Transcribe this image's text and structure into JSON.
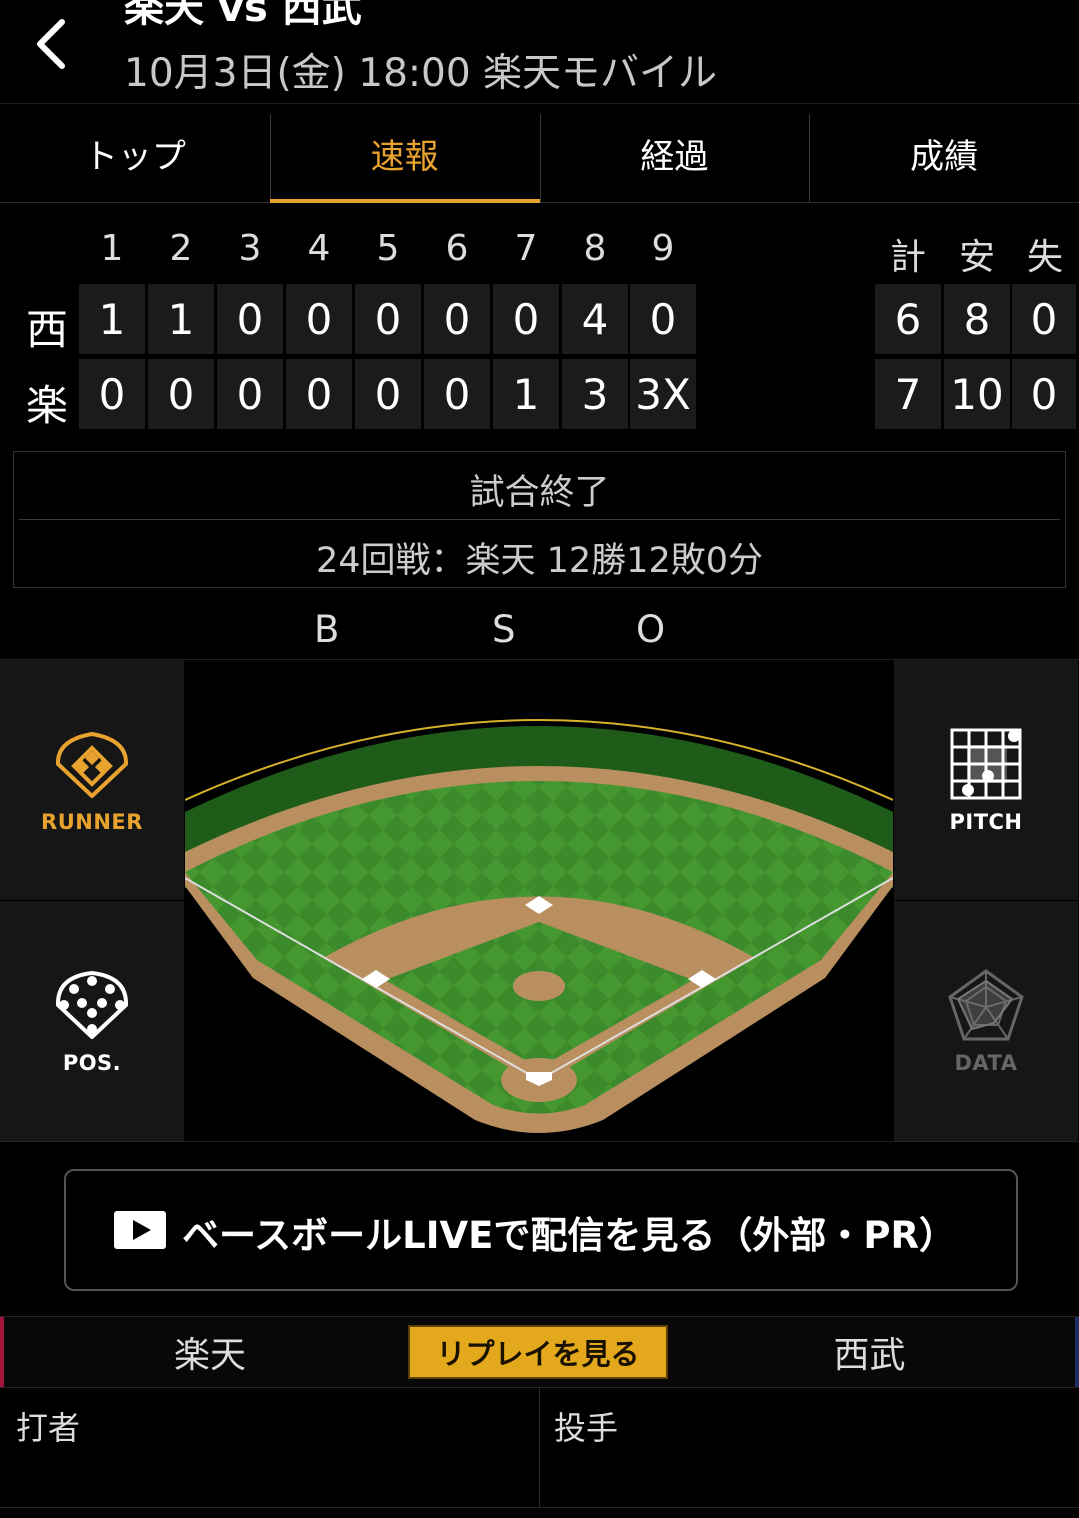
{
  "header": {
    "title": "楽天 vs 西武",
    "subtitle": "10月3日(金) 18:00 楽天モバイル"
  },
  "tabs": [
    {
      "label": "トップ",
      "active": false
    },
    {
      "label": "速報",
      "active": true
    },
    {
      "label": "経過",
      "active": false
    },
    {
      "label": "成績",
      "active": false
    }
  ],
  "scoreboard": {
    "innings": [
      "1",
      "2",
      "3",
      "4",
      "5",
      "6",
      "7",
      "8",
      "9"
    ],
    "totals_headers": [
      "計",
      "安",
      "失"
    ],
    "rows": [
      {
        "team": "西",
        "scores": [
          "1",
          "1",
          "0",
          "0",
          "0",
          "0",
          "0",
          "4",
          "0"
        ],
        "totals": [
          "6",
          "8",
          "0"
        ]
      },
      {
        "team": "楽",
        "scores": [
          "0",
          "0",
          "0",
          "0",
          "0",
          "0",
          "1",
          "3",
          "3X"
        ],
        "totals": [
          "7",
          "10",
          "0"
        ]
      }
    ]
  },
  "game_status": {
    "status": "試合終了",
    "record": "24回戦：楽天 12勝12敗0分"
  },
  "count": {
    "b": "B",
    "s": "S",
    "o": "O"
  },
  "side_buttons": {
    "runner": "RUNNER",
    "pos": "POS.",
    "pitch": "PITCH",
    "data": "DATA"
  },
  "live_button": {
    "label": "ベースボールLIVEで配信を見る（外部・PR）"
  },
  "team_tabs": {
    "home": "楽天",
    "away": "西武",
    "replay": "リプレイを見る"
  },
  "panels": {
    "batter": "打者",
    "pitcher": "投手"
  },
  "colors": {
    "accent": "#e8a22e",
    "home_team": "#a3163a",
    "away_team": "#1c2e64",
    "grass": "#3d8a2c",
    "dirt": "#b98f5f"
  }
}
